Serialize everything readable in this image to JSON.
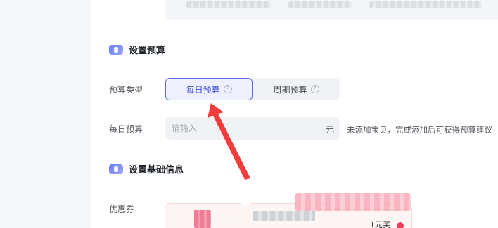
{
  "budget_section": {
    "title": "设置预算",
    "icon": "ticket-icon",
    "type_label": "预算类型",
    "options": [
      {
        "label": "每日预算",
        "active": true
      },
      {
        "label": "周期预算",
        "active": false
      }
    ],
    "daily_label": "每日预算",
    "input_placeholder": "请输入",
    "unit": "元",
    "hint": "未添加宝贝，完成添加后可获得预算建议"
  },
  "basic_section": {
    "title": "设置基础信息",
    "icon": "disc-icon",
    "coupon_label": "优惠券",
    "coupon_price": "1元买"
  },
  "colors": {
    "accent": "#5e6ae8",
    "annotation_arrow": "#f23c3c",
    "badge": "#f23c57"
  }
}
